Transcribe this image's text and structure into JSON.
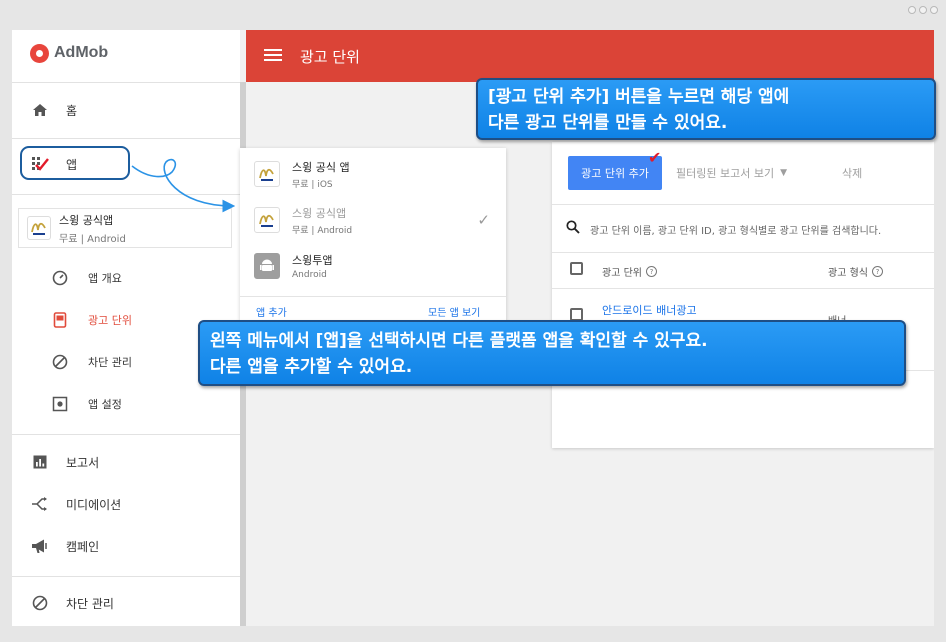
{
  "app": {
    "logo_text": "AdMob"
  },
  "topbar": {
    "title": "광고 단위"
  },
  "sidebar": {
    "home": "홈",
    "apps": "앱",
    "current_app": {
      "name": "스윙 공식앱",
      "sub": "무료 | Android"
    },
    "sub_items": [
      "앱 개요",
      "광고 단위",
      "차단 관리",
      "앱 설정"
    ],
    "bottom_items": [
      "보고서",
      "미디에이션",
      "캠페인"
    ],
    "block": "차단 관리"
  },
  "dropdown": {
    "items": [
      {
        "name": "스윙 공식 앱",
        "sub": "무료 | iOS"
      },
      {
        "name": "스윙 공식앱",
        "sub": "무료 | Android"
      },
      {
        "name": "스윙투앱",
        "sub": "Android"
      }
    ],
    "add_app": "앱 추가",
    "view_all": "모든 앱 보기"
  },
  "card": {
    "add_button": "광고 단위 추가",
    "filter_report": "필터링된 보고서 보기",
    "delete": "삭제",
    "search_placeholder": "광고 단위 이름, 광고 단위 ID, 광고 형식별로 광고 단위를 검색합니다.",
    "col_ad_unit": "광고 단위",
    "col_format": "광고 형식",
    "row": {
      "name": "안드로이드 배너광고",
      "format": "배너"
    }
  },
  "callouts": {
    "top_line1": "[광고 단위 추가] 버튼을 누르면 해당 앱에",
    "top_line2": "다른 광고 단위를 만들 수 있어요.",
    "mid_line1": "왼쪽 메뉴에서 [앱]을 선택하시면 다른 플랫폼 앱을 확인할 수 있구요.",
    "mid_line2": "다른 앱을  추가할 수 있어요."
  },
  "colors": {
    "accent_red": "#db4437",
    "blue": "#4285f4",
    "callout_blue": "#1a8cf0"
  }
}
